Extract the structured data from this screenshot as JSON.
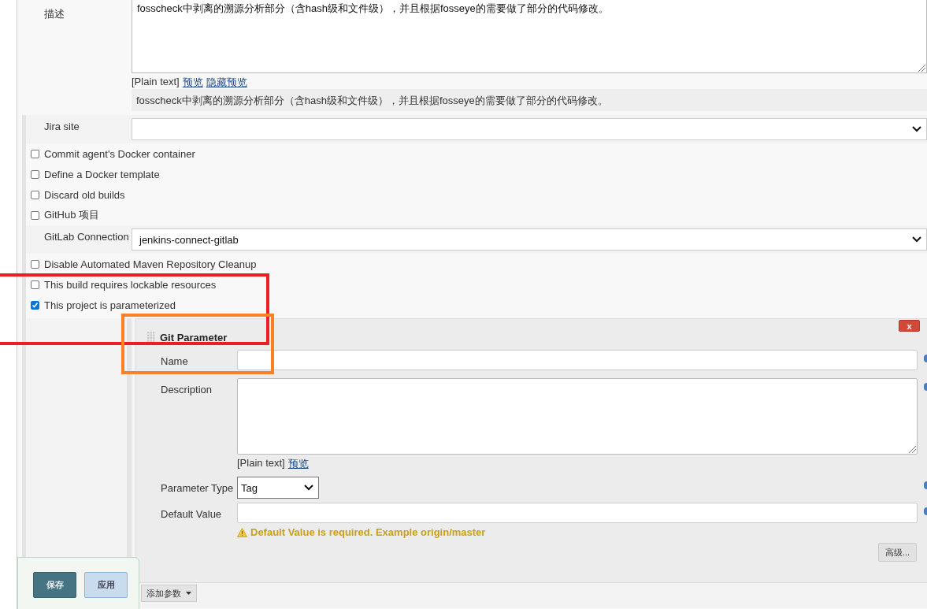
{
  "description": {
    "label": "描述",
    "value": "fosscheck中剥离的溯源分析部分（含hash级和文件级），并且根据fosseye的需要做了部分的代码修改。",
    "format": "[Plain text]",
    "links": [
      "预览",
      "隐藏预览"
    ],
    "preview": "fosscheck中剥离的溯源分析部分（含hash级和文件级），并且根据fosseye的需要做了部分的代码修改。"
  },
  "options": [
    {
      "kind": "select",
      "label": "Jira site"
    },
    {
      "kind": "checkbox",
      "label": "Commit agent's Docker container",
      "checked": false
    },
    {
      "kind": "checkbox",
      "label": "Define a Docker template",
      "checked": false
    },
    {
      "kind": "checkbox",
      "label": "Discard old builds",
      "checked": false
    },
    {
      "kind": "checkbox",
      "label": "GitHub 项目",
      "checked": false
    },
    {
      "kind": "select",
      "label": "GitLab Connection",
      "value": "jenkins-connect-gitlab"
    },
    {
      "kind": "checkbox",
      "label": "Disable Automated Maven Repository Cleanup",
      "checked": false
    },
    {
      "kind": "checkbox",
      "label": "This build requires lockable resources",
      "checked": false
    },
    {
      "kind": "checkbox",
      "label": "This project is parameterized",
      "checked": true
    }
  ],
  "parameter": {
    "title": "Git Parameter",
    "delete_button": "x",
    "fields": [
      {
        "kind": "input",
        "label": "Name"
      },
      {
        "kind": "textarea",
        "label": "Description",
        "format": "[Plain text]",
        "link": "预览"
      },
      {
        "kind": "select",
        "label": "Parameter Type",
        "value": "Tag"
      },
      {
        "kind": "input",
        "label": "Default Value",
        "warning": "Default Value is required. Example origin/master"
      }
    ],
    "advanced_button": "高级..."
  },
  "add_parameter_button": "添加参数",
  "save_bar": {
    "buttons": [
      {
        "label": "保存",
        "kind": "primary"
      },
      {
        "label": "应用",
        "kind": "secondary"
      }
    ]
  },
  "annotations": [
    {
      "color": "#ee1c25"
    },
    {
      "color": "#ff7f27"
    }
  ]
}
